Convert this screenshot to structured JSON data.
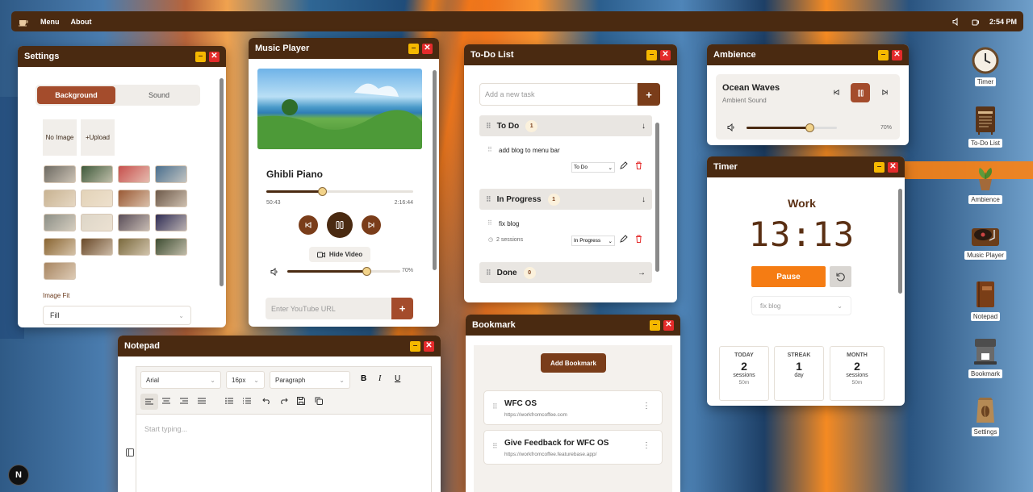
{
  "topbar": {
    "menu": "Menu",
    "about": "About",
    "time": "2:54 PM"
  },
  "settings": {
    "title": "Settings",
    "tab_background": "Background",
    "tab_sound": "Sound",
    "no_image": "No Image",
    "upload": "+Upload",
    "image_fit_label": "Image Fit",
    "image_fit_value": "Fill",
    "thumb_colors": [
      "#6d6a62",
      "#3f5a3b",
      "#c7504d",
      "#4a6f8e",
      "#c8b392",
      "#e3d3b8",
      "#9a5a35",
      "#6e5a4a",
      "#8c8f86",
      "#ddd6c8",
      "#5a4e59",
      "#2f2d55",
      "#8a6633",
      "#6a4a2a",
      "#7b6a3e",
      "#3f4e33",
      "#a88662"
    ]
  },
  "music": {
    "title": "Music Player",
    "track": "Ghibli Piano",
    "elapsed": "50:43",
    "duration": "2:16:44",
    "progress": 0.38,
    "hide_video": "Hide Video",
    "volume": "70%",
    "volume_level": 0.7,
    "url_placeholder": "Enter YouTube URL"
  },
  "todo": {
    "title": "To-Do List",
    "placeholder": "Add a new task",
    "sections": [
      {
        "name": "To Do",
        "count": "1",
        "task": "add blog to menu bar",
        "status": "To Do"
      },
      {
        "name": "In Progress",
        "count": "1",
        "task": "fix blog",
        "status": "In Progress",
        "sessions": "2 sessions"
      },
      {
        "name": "Done",
        "count": "0"
      }
    ]
  },
  "bookmark": {
    "title": "Bookmark",
    "add_button": "Add Bookmark",
    "items": [
      {
        "name": "WFC OS",
        "url": "https://workfromcoffee.com"
      },
      {
        "name": "Give Feedback for WFC OS",
        "url": "https://workfromcoffee.featurebase.app/"
      }
    ]
  },
  "ambience": {
    "title": "Ambience",
    "sound": "Ocean Waves",
    "subtitle": "Ambient Sound",
    "volume": "70%",
    "volume_level": 0.7
  },
  "timer": {
    "title": "Timer",
    "mode": "Work",
    "time": "13:13",
    "pause": "Pause",
    "task_select": "fix blog",
    "stats": [
      {
        "label": "TODAY",
        "value": "2",
        "unit": "sessions",
        "sub": "50m"
      },
      {
        "label": "STREAK",
        "value": "1",
        "unit": "day",
        "sub": ""
      },
      {
        "label": "MONTH",
        "value": "2",
        "unit": "sessions",
        "sub": "50m"
      }
    ]
  },
  "notepad": {
    "title": "Notepad",
    "font": "Arial",
    "size": "16px",
    "block": "Paragraph",
    "placeholder": "Start typing..."
  },
  "desktop": {
    "icons": [
      "Timer",
      "To-Do List",
      "Ambience",
      "Music Player",
      "Notepad",
      "Bookmark",
      "Settings"
    ]
  },
  "badge": "N",
  "colors": {
    "brown": "#4a2a11",
    "accent": "#a44c2c",
    "orange": "#f57c13"
  }
}
